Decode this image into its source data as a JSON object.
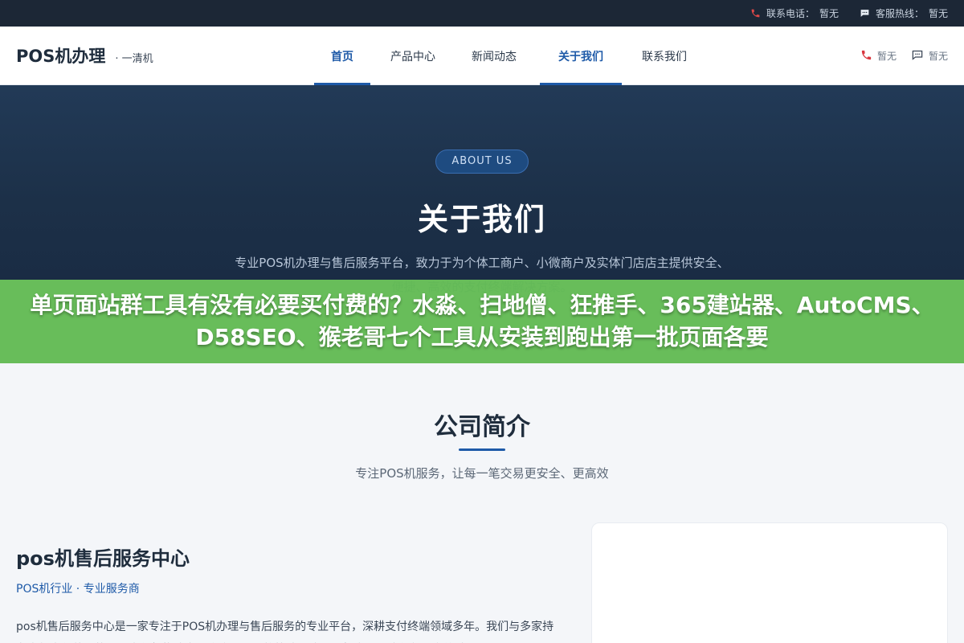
{
  "topbar": {
    "phone_label": "联系电话：",
    "phone_value": "暂无",
    "service_label": "客服热线：",
    "service_value": "暂无"
  },
  "header": {
    "brand_name": "POS机办理",
    "brand_sub": "· 一清机",
    "nav": [
      {
        "label": "首页",
        "active": true
      },
      {
        "label": "产品中心",
        "active": false
      },
      {
        "label": "新闻动态",
        "active": false
      },
      {
        "label": "关于我们",
        "active": true
      },
      {
        "label": "联系我们",
        "active": false
      }
    ],
    "right_phone": "暂无",
    "right_chat": "暂无"
  },
  "hero": {
    "pill": "ABOUT US",
    "title": "关于我们",
    "description": "专业POS机办理与售后服务平台，致力于为个体工商户、小微商户及实体门店店主提供安全、便捷、高效的支付终端解决方案。"
  },
  "banner": {
    "text": "单页面站群工具有没有必要买付费的？水淼、扫地僧、狂推手、365建站器、AutoCMS、D58SEO、猴老哥七个工具从安装到跑出第一批页面各要"
  },
  "section": {
    "title": "公司简介",
    "subtitle": "专注POS机服务，让每一笔交易更安全、更高效"
  },
  "company": {
    "name": "pos机售后服务中心",
    "tag": "POS机行业 · 专业服务商",
    "intro": "pos机售后服务中心是一家专注于POS机办理与售后服务的专业平台，深耕支付终端领域多年。我们与多家持有央行支付牌照的正规支付机构建立深度合作，严格筛选一清POS机产品，确保每一台终端"
  },
  "colors": {
    "accent": "#1e5aa8",
    "topbar_bg": "#1c2736",
    "hero_bg": "#1c3048",
    "banner_bg": "#5cb84e",
    "phone_icon": "#d9363e"
  }
}
